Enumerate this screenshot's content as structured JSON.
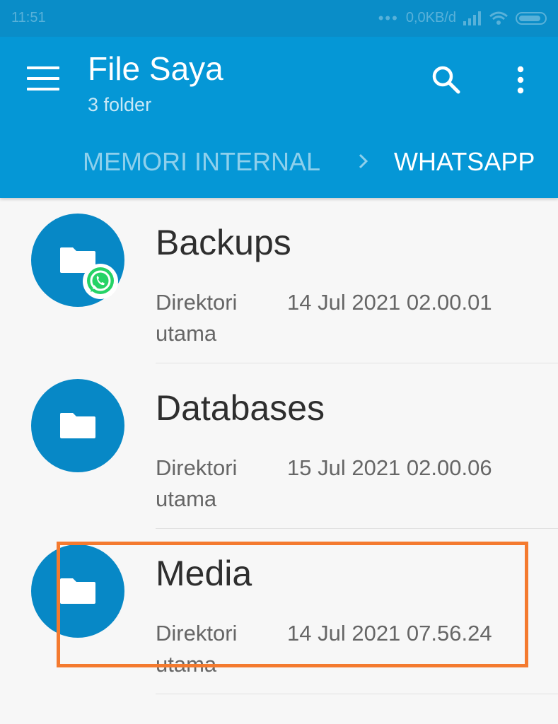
{
  "status_bar": {
    "time": "11:51",
    "network_speed": "0,0KB/d"
  },
  "app_bar": {
    "title": "File Saya",
    "subtitle": "3 folder",
    "icons": {
      "menu": "hamburger-menu-icon",
      "search": "search-icon",
      "more": "more-vert-icon"
    }
  },
  "breadcrumb": {
    "items": [
      {
        "label": "MEMORI INTERNAL"
      },
      {
        "label": "WHATSAPP"
      }
    ]
  },
  "folders": [
    {
      "name": "Backups",
      "type": "Direktori utama",
      "date": "14 Jul 2021 02.00.01",
      "badge": "whatsapp-icon"
    },
    {
      "name": "Databases",
      "type": "Direktori utama",
      "date": "15 Jul 2021 02.00.06"
    },
    {
      "name": "Media",
      "type": "Direktori utama",
      "date": "14 Jul 2021 07.56.24",
      "highlighted": true
    }
  ],
  "colors": {
    "app_bar": "#0597d6",
    "folder_circle": "#0788c6",
    "highlight": "#f47a2f",
    "whatsapp": "#25d366"
  }
}
